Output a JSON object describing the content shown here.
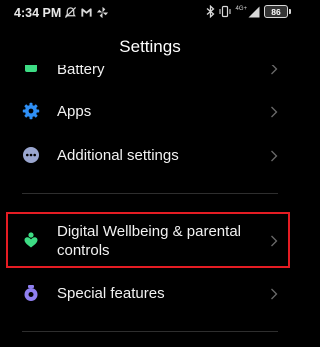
{
  "status_bar": {
    "time": "4:34 PM",
    "left_icons": [
      "no-notifications-icon",
      "gmail-icon",
      "pinwheel-icon"
    ],
    "right_icons": [
      "bluetooth-icon",
      "vibrate-icon",
      "4g-signal-icon"
    ],
    "network_label": "4G+",
    "battery_level": "86"
  },
  "header": {
    "title": "Settings"
  },
  "settings": {
    "items": [
      {
        "label": "Battery",
        "icon": "battery-icon",
        "color": "#3ddc84"
      },
      {
        "label": "Apps",
        "icon": "gear-icon",
        "color": "#2f8ff5"
      },
      {
        "label": "Additional settings",
        "icon": "more-dots-icon",
        "color": "#9aa6cf"
      },
      {
        "label": "Digital Wellbeing & parental controls",
        "icon": "wellbeing-icon",
        "color": "#3ddc84"
      },
      {
        "label": "Special features",
        "icon": "special-features-icon",
        "color": "#8f7ff0"
      }
    ]
  },
  "highlight_color": "#e51c23"
}
